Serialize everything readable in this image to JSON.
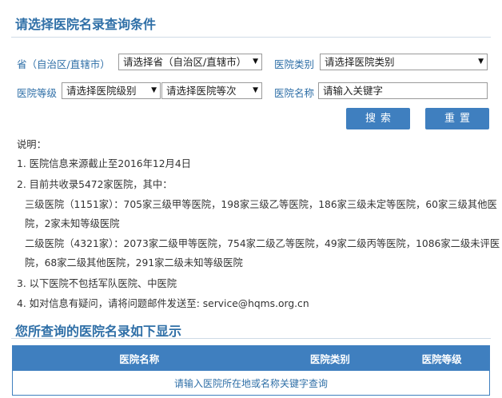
{
  "titles": {
    "filter_title": "请选择医院名录查询条件",
    "results_title": "您所查询的医院名录如下显示"
  },
  "filters": {
    "province_label": "省（自治区/直辖市）",
    "province_select": "请选择省（自治区/直辖市）",
    "category_label": "医院类别",
    "category_select": "请选择医院类别",
    "level_label": "医院等级",
    "level_select": "请选择医院级别",
    "grade_select": "请选择医院等次",
    "name_label": "医院名称",
    "name_value": "请输入关键字"
  },
  "buttons": {
    "search": "搜索",
    "reset": "重置"
  },
  "notes": {
    "heading": "说明：",
    "n1": "1. 医院信息来源截止至2016年12月4日",
    "n2": "2. 目前共收录5472家医院，其中：",
    "n2a_1": "三级医院（1151家）：705家三级甲等医院，198家三级乙等医院，186家三级未定等医院，60家三级其他医",
    "n2a_2": "院，2家未知等级医院",
    "n2b_1": "二级医院（4321家）：2073家二级甲等医院，754家二级乙等医院，49家二级丙等医院，1086家二级未评医",
    "n2b_2": "院，68家二级其他医院，291家二级未知等级医院",
    "n3": "3. 以下医院不包括军队医院、中医院",
    "n4": "4. 如对信息有疑问，请将问题邮件发送至: service@hqms.org.cn"
  },
  "table": {
    "headers": [
      "医院名称",
      "医院类别",
      "医院等级"
    ],
    "empty_message": "请输入医院所在地或名称关键字查询"
  },
  "icons": {
    "dropdown": "chevron-down-icon"
  },
  "colors": {
    "accent": "#3f7fbf",
    "title": "#2f6fa7"
  }
}
